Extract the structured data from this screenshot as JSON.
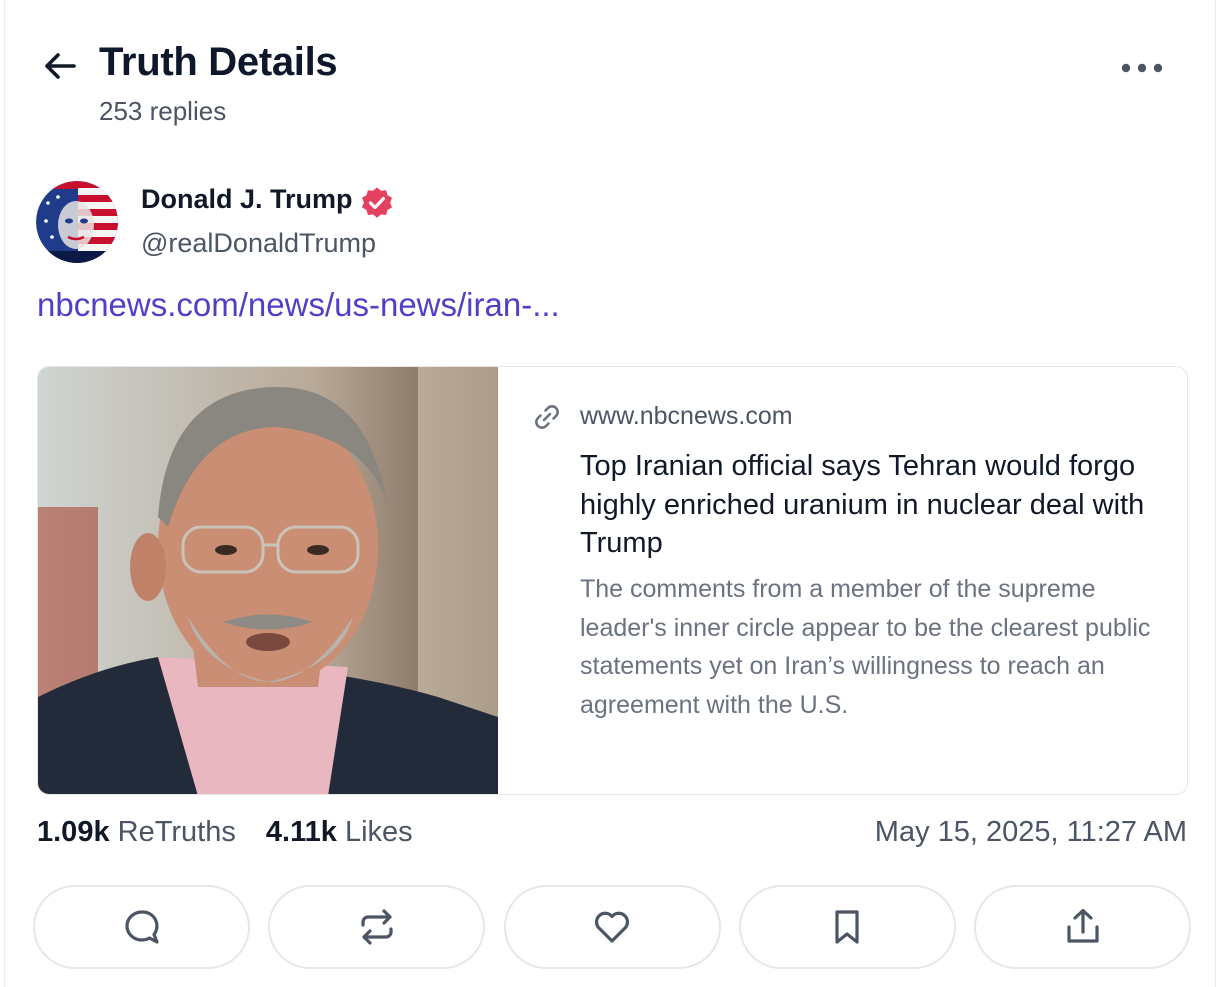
{
  "header": {
    "title": "Truth Details",
    "reply_count": "253 replies"
  },
  "post": {
    "author_name": "Donald J. Trump",
    "author_handle": "@realDonaldTrump",
    "link_text": "nbcnews.com/news/us-news/iran-...",
    "card": {
      "domain": "www.nbcnews.com",
      "title": "Top Iranian official says Tehran would forgo highly enriched uranium in nuclear deal with Trump",
      "description": "The comments from a member of the supreme leader's inner circle appear to be the clearest public statements yet on Iran’s willingness to reach an agreement with the U.S."
    },
    "retruths_count": "1.09k",
    "retruths_label": "ReTruths",
    "likes_count": "4.11k",
    "likes_label": "Likes",
    "timestamp": "May 15, 2025, 11:27 AM"
  },
  "icons": {
    "back": "arrow-left-icon",
    "more": "more-horizontal-icon",
    "verified": "verified-badge-icon",
    "link": "link-icon",
    "reply": "reply-icon",
    "retruth": "retruth-icon",
    "like": "heart-icon",
    "bookmark": "bookmark-icon",
    "share": "share-icon"
  },
  "colors": {
    "link": "#4f3fc9",
    "verified": "#e4405f",
    "muted": "#4b5563"
  }
}
